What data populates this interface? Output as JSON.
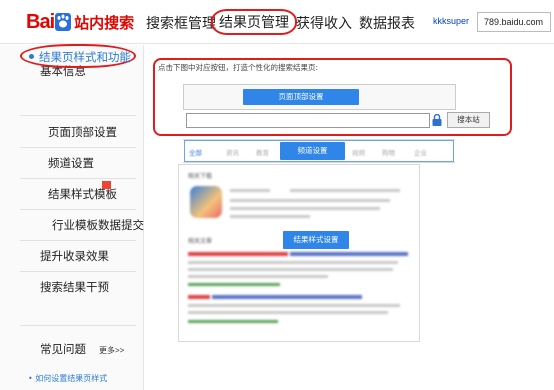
{
  "header": {
    "logo_text_bai": "Bai",
    "logo_text_du": "du",
    "logo_suffix": "站内搜索",
    "nav": [
      "搜索框管理",
      "结果页管理",
      "获得收入",
      "数据报表"
    ],
    "active_nav_index": 1,
    "username": "kkksuper",
    "domain": "789.baidu.com"
  },
  "sidebar": {
    "items": [
      "基本信息",
      "结果页样式和功能",
      "页面顶部设置",
      "频道设置",
      "结果样式模板",
      "行业模板数据提交",
      "提升收录效果",
      "搜索结果干预"
    ],
    "selected_index": 1,
    "help_title": "常见问题",
    "more": "更多>>",
    "help_link": "• 如何设置结果页样式"
  },
  "main": {
    "instruction": "点击下图中对应按钮，打造个性化的搜索结果页:",
    "top_setting_button": "页面顶部设置",
    "search_button": "搜本站",
    "channel_button": "频道设置",
    "result_style_button": "结果样式设置",
    "tabs": [
      "全部",
      "资讯",
      "教育",
      "",
      "视频",
      "购物",
      "企业"
    ],
    "result_heading_1": "相关下载",
    "result_heading_2": "相关文章"
  },
  "colors": {
    "brand_red": "#e10602",
    "highlight_red": "#e01c1c",
    "accent_blue": "#2f86e8",
    "link_blue": "#2b7bd6"
  }
}
